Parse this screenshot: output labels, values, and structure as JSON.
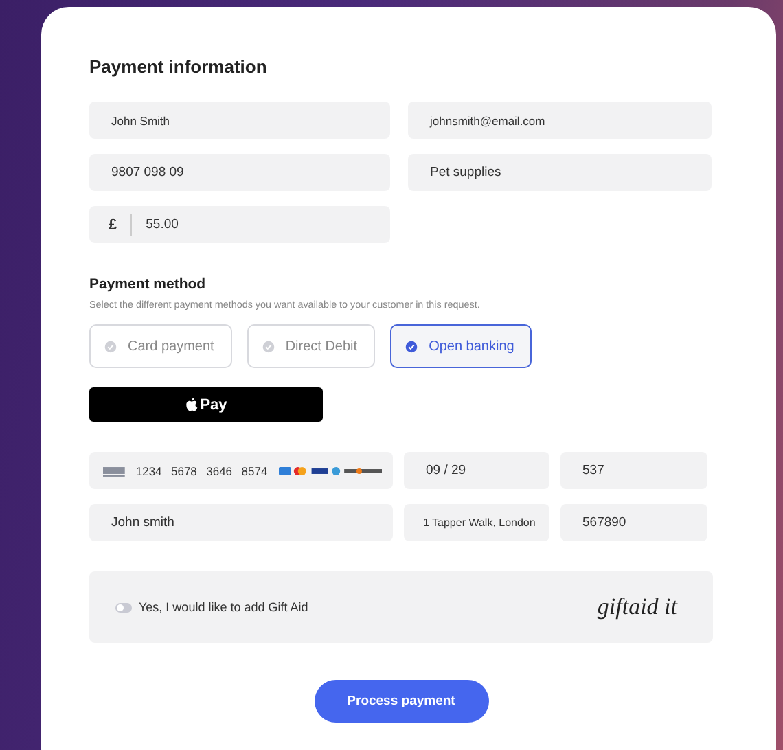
{
  "heading": "Payment information",
  "fields": [
    {
      "value": "John Smith"
    },
    {
      "value": "johnsmith@email.com"
    },
    {
      "value": "9807 098 09"
    },
    {
      "value": "Pet supplies"
    }
  ],
  "amount": {
    "currency": "£",
    "value": "55.00"
  },
  "payment_method": {
    "title": "Payment method",
    "description": "Select the different payment methods you want available to your  customer in this request.",
    "options": [
      {
        "label": "Card payment",
        "selected": false
      },
      {
        "label": "Direct Debit",
        "selected": false
      },
      {
        "label": "Open banking",
        "selected": true
      }
    ]
  },
  "apple_pay": {
    "label": "Pay"
  },
  "card": {
    "number": "1234  5678  3646  8574",
    "expiry": "09 / 29",
    "cvv": "537",
    "name": "John smith",
    "address": "1 Tapper Walk, London",
    "postcode": "567890"
  },
  "gift_aid": {
    "label": "Yes, I would like to add Gift Aid",
    "on": false,
    "logo": "giftaid it"
  },
  "submit": "Process payment"
}
